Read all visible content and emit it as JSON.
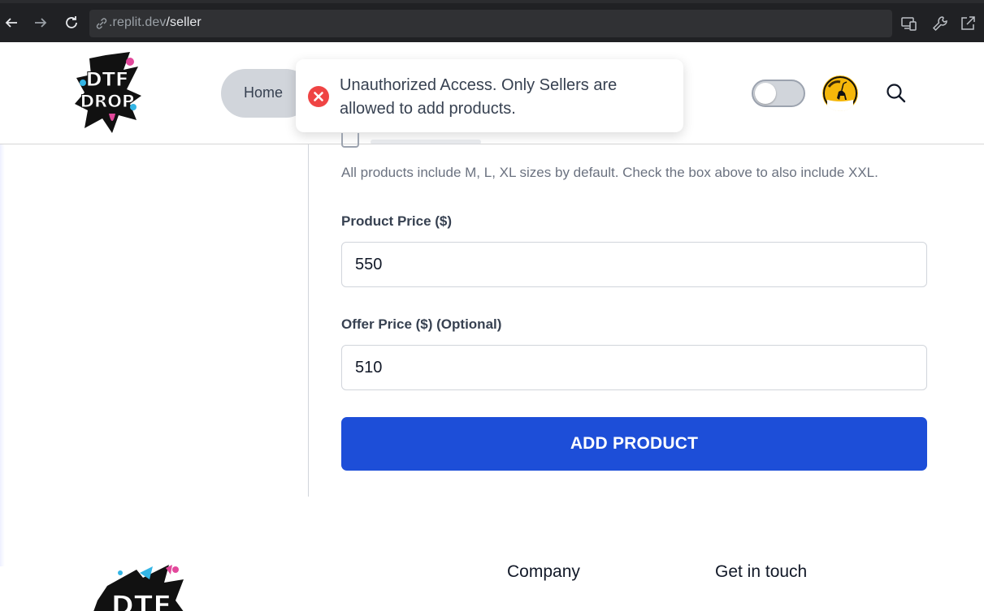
{
  "browser": {
    "url_host": ".replit.dev",
    "url_path": "/seller",
    "back_icon": "arrow-left-icon",
    "forward_icon": "arrow-right-icon",
    "reload_icon": "reload-icon"
  },
  "header": {
    "nav_home": "Home",
    "logo_text_top": "DTF",
    "logo_text_bottom": "DROP"
  },
  "toast": {
    "type": "error",
    "message": "Unauthorized Access. Only Sellers are allowed to add products."
  },
  "form": {
    "sizes_hint": "All products include M, L, XL sizes by default. Check the box above to also include XXL.",
    "price_label": "Product Price ($)",
    "price_value": "550",
    "offer_label": "Offer Price ($) (Optional)",
    "offer_value": "510",
    "submit_label": "ADD PRODUCT"
  },
  "footer": {
    "company_heading": "Company",
    "contact_heading": "Get in touch"
  },
  "colors": {
    "primary_button": "#1d4ed8",
    "error": "#ef4444",
    "nav_pill": "#d1d5db"
  }
}
